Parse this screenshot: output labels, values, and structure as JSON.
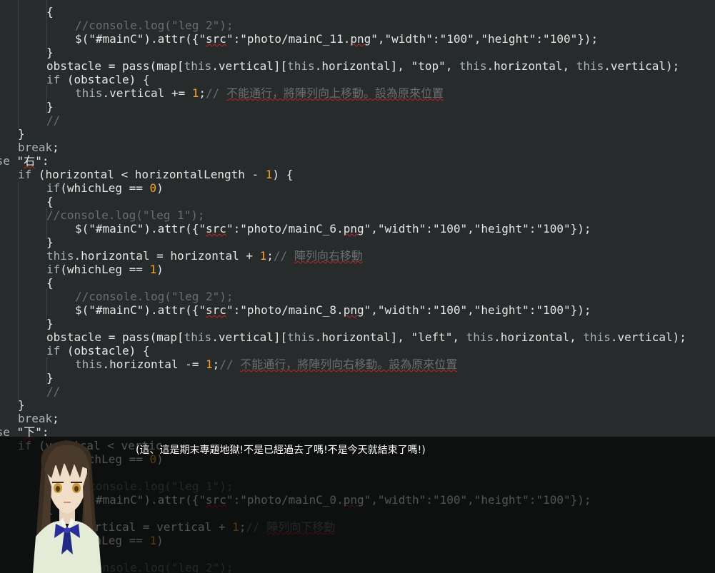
{
  "code_lines": [
    {
      "indent": 65,
      "segments": [
        {
          "t": "{"
        }
      ]
    },
    {
      "indent": 105,
      "segments": [
        {
          "t": "//console.log(\"leg 2\");",
          "c": "cm"
        }
      ]
    },
    {
      "indent": 105,
      "segments": [
        {
          "t": "$(\"#mainC\").attr({\""
        },
        {
          "t": "src",
          "c": "sq"
        },
        {
          "t": "\":\"photo/mainC_11."
        },
        {
          "t": "png",
          "c": "sq"
        },
        {
          "t": "\",\"width\":\"100\",\"height\":\"100\"});"
        }
      ]
    },
    {
      "indent": 65,
      "segments": [
        {
          "t": "}"
        }
      ]
    },
    {
      "indent": 65,
      "segments": [
        {
          "t": "obstacle = pass(map["
        },
        {
          "t": "this",
          "c": "th"
        },
        {
          "t": ".vertical]["
        },
        {
          "t": "this",
          "c": "th"
        },
        {
          "t": ".horizontal], \"top\", "
        },
        {
          "t": "this",
          "c": "th"
        },
        {
          "t": ".horizontal, "
        },
        {
          "t": "this",
          "c": "th"
        },
        {
          "t": ".vertical);"
        }
      ]
    },
    {
      "indent": 65,
      "segments": [
        {
          "t": "if",
          "c": "kw"
        },
        {
          "t": " (obstacle) {"
        }
      ]
    },
    {
      "indent": 105,
      "segments": [
        {
          "t": "this",
          "c": "th"
        },
        {
          "t": ".vertical += "
        },
        {
          "t": "1",
          "c": "num"
        },
        {
          "t": ";"
        },
        {
          "t": "// ",
          "c": "cm"
        },
        {
          "t": "不能通行，將陣列向上移動。設為原來位置",
          "c": "cmzh"
        }
      ]
    },
    {
      "indent": 65,
      "segments": [
        {
          "t": "}"
        }
      ]
    },
    {
      "indent": 65,
      "segments": [
        {
          "t": "//",
          "c": "cm"
        }
      ]
    },
    {
      "indent": 25,
      "segments": [
        {
          "t": "}"
        }
      ]
    },
    {
      "indent": 25,
      "segments": [
        {
          "t": "break",
          "c": "kw"
        },
        {
          "t": ";"
        }
      ]
    },
    {
      "indent": -15,
      "segments": [
        {
          "t": "ase",
          "c": "kw"
        },
        {
          "t": " \""
        },
        {
          "t": "右",
          "c": "sq"
        },
        {
          "t": "\":"
        }
      ]
    },
    {
      "indent": 25,
      "segments": [
        {
          "t": "if",
          "c": "kw"
        },
        {
          "t": " (horizontal < horizontalLength - "
        },
        {
          "t": "1",
          "c": "num"
        },
        {
          "t": ") {"
        }
      ]
    },
    {
      "indent": 65,
      "segments": [
        {
          "t": "if",
          "c": "kw"
        },
        {
          "t": "(whichLeg == "
        },
        {
          "t": "0",
          "c": "num"
        },
        {
          "t": ")"
        }
      ]
    },
    {
      "indent": 65,
      "segments": [
        {
          "t": "{"
        }
      ]
    },
    {
      "indent": 65,
      "segments": [
        {
          "t": "//console.log(\"leg 1\");",
          "c": "cm"
        }
      ]
    },
    {
      "indent": 105,
      "segments": [
        {
          "t": "$(\"#mainC\").attr({\""
        },
        {
          "t": "src",
          "c": "sq"
        },
        {
          "t": "\":\"photo/mainC_6."
        },
        {
          "t": "png",
          "c": "sq"
        },
        {
          "t": "\",\"width\":\"100\",\"height\":\"100\"});"
        }
      ]
    },
    {
      "indent": 65,
      "segments": [
        {
          "t": "}"
        }
      ]
    },
    {
      "indent": 65,
      "segments": [
        {
          "t": "this",
          "c": "th"
        },
        {
          "t": ".horizontal = horizontal + "
        },
        {
          "t": "1",
          "c": "num"
        },
        {
          "t": ";"
        },
        {
          "t": "// ",
          "c": "cm"
        },
        {
          "t": "陣列向右移動",
          "c": "cmzh"
        }
      ]
    },
    {
      "indent": 65,
      "segments": [
        {
          "t": "if",
          "c": "kw"
        },
        {
          "t": "(whichLeg == "
        },
        {
          "t": "1",
          "c": "num"
        },
        {
          "t": ")"
        }
      ]
    },
    {
      "indent": 65,
      "segments": [
        {
          "t": "{"
        }
      ]
    },
    {
      "indent": 105,
      "segments": [
        {
          "t": "//console.log(\"leg 2\");",
          "c": "cm"
        }
      ]
    },
    {
      "indent": 105,
      "segments": [
        {
          "t": "$(\"#mainC\").attr({\""
        },
        {
          "t": "src",
          "c": "sq"
        },
        {
          "t": "\":\"photo/mainC_8."
        },
        {
          "t": "png",
          "c": "sq"
        },
        {
          "t": "\",\"width\":\"100\",\"height\":\"100\"});"
        }
      ]
    },
    {
      "indent": 65,
      "segments": [
        {
          "t": "}"
        }
      ]
    },
    {
      "indent": 65,
      "segments": [
        {
          "t": "obstacle = pass(map["
        },
        {
          "t": "this",
          "c": "th"
        },
        {
          "t": ".vertical]["
        },
        {
          "t": "this",
          "c": "th"
        },
        {
          "t": ".horizontal], \"left\", "
        },
        {
          "t": "this",
          "c": "th"
        },
        {
          "t": ".horizontal, "
        },
        {
          "t": "this",
          "c": "th"
        },
        {
          "t": ".vertical);"
        }
      ]
    },
    {
      "indent": 65,
      "segments": [
        {
          "t": "if",
          "c": "kw"
        },
        {
          "t": " (obstacle) {"
        }
      ]
    },
    {
      "indent": 105,
      "segments": [
        {
          "t": "this",
          "c": "th"
        },
        {
          "t": ".horizontal -= "
        },
        {
          "t": "1",
          "c": "num"
        },
        {
          "t": ";"
        },
        {
          "t": "// ",
          "c": "cm"
        },
        {
          "t": "不能通行，將陣列向右移動。設為原來位置",
          "c": "cmzh"
        }
      ]
    },
    {
      "indent": 65,
      "segments": [
        {
          "t": "}"
        }
      ]
    },
    {
      "indent": 65,
      "segments": [
        {
          "t": "//",
          "c": "cm"
        }
      ]
    },
    {
      "indent": 25,
      "segments": [
        {
          "t": "}"
        }
      ]
    },
    {
      "indent": 25,
      "segments": [
        {
          "t": "break",
          "c": "kw"
        },
        {
          "t": ";"
        }
      ]
    },
    {
      "indent": -15,
      "segments": [
        {
          "t": "ase",
          "c": "kw"
        },
        {
          "t": " \""
        },
        {
          "t": "下",
          "c": "sq"
        },
        {
          "t": "\":"
        }
      ]
    },
    {
      "indent": 25,
      "segments": [
        {
          "t": "if",
          "c": "kw"
        },
        {
          "t": " (vertical < vertic"
        }
      ]
    },
    {
      "indent": 65,
      "segments": [
        {
          "t": "if",
          "c": "kw"
        },
        {
          "t": "(whichLeg == "
        },
        {
          "t": "0",
          "c": "num"
        },
        {
          "t": ")"
        }
      ]
    },
    {
      "indent": 65,
      "segments": [
        {
          "t": "{"
        }
      ]
    },
    {
      "indent": 105,
      "segments": [
        {
          "t": "//console.log(\"leg 1\");",
          "c": "cm"
        }
      ]
    },
    {
      "indent": 105,
      "segments": [
        {
          "t": "$(\"#mainC\").attr({\""
        },
        {
          "t": "src",
          "c": "sq"
        },
        {
          "t": "\":\"photo/mainC_0."
        },
        {
          "t": "png",
          "c": "sq"
        },
        {
          "t": "\",\"width\":\"100\",\"height\":\"100\"});"
        }
      ]
    },
    {
      "indent": 65,
      "segments": [
        {
          "t": "}"
        }
      ]
    },
    {
      "indent": 65,
      "segments": [
        {
          "t": "this",
          "c": "th"
        },
        {
          "t": ".vertical = vertical + "
        },
        {
          "t": "1",
          "c": "num"
        },
        {
          "t": ";"
        },
        {
          "t": "// ",
          "c": "cm"
        },
        {
          "t": "陣列向下移動",
          "c": "cmzh"
        }
      ]
    },
    {
      "indent": 65,
      "segments": [
        {
          "t": "if",
          "c": "kw"
        },
        {
          "t": "(whichLeg == "
        },
        {
          "t": "1",
          "c": "num"
        },
        {
          "t": ")"
        }
      ]
    },
    {
      "indent": 65,
      "segments": [
        {
          "t": "{"
        }
      ]
    },
    {
      "indent": 105,
      "segments": [
        {
          "t": "//console.log(\"leg 2\");",
          "c": "cm"
        }
      ]
    }
  ],
  "dialog": {
    "text": "(這、這是期末專題地獄!不是已經過去了嗎!不是今天就結束了嗎!)"
  },
  "colors": {
    "editor_bg": "#272b2c",
    "plain": "#e6e6e6",
    "keyword": "#a9b4b8",
    "number": "#f7a42e",
    "comment": "#6a6e70",
    "squiggle": "#c52323",
    "dialog_bg": "rgba(0,0,0,0.64)"
  }
}
